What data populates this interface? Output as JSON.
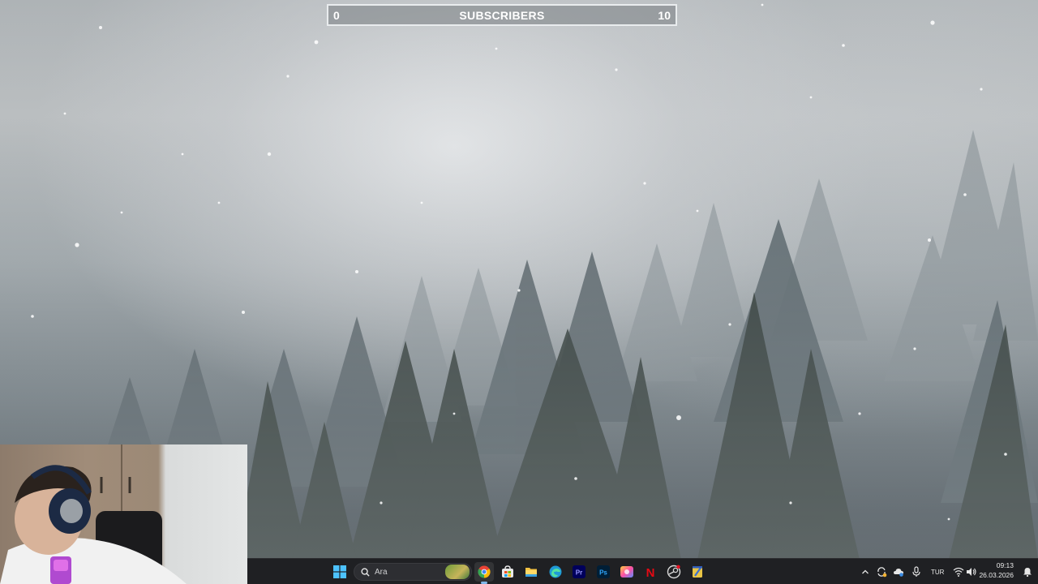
{
  "subscribers": {
    "current": "0",
    "title": "SUBSCRIBERS",
    "goal": "10",
    "progress": 0
  },
  "taskbar": {
    "search_label": "Ara",
    "apps": [
      {
        "name": "chrome-icon",
        "active": true
      },
      {
        "name": "store-icon",
        "active": false
      },
      {
        "name": "file-explorer-icon",
        "active": false
      },
      {
        "name": "edge-icon",
        "active": false
      },
      {
        "name": "premiere-pro-icon",
        "active": false
      },
      {
        "name": "photoshop-icon",
        "active": false
      },
      {
        "name": "color-app-icon",
        "active": false
      },
      {
        "name": "netflix-icon",
        "active": false
      },
      {
        "name": "steam-icon",
        "active": false
      },
      {
        "name": "notepad-icon",
        "active": false
      }
    ],
    "premiere_label": "Pr",
    "photoshop_label": "Ps",
    "netflix_label": "N",
    "language": "TUR",
    "time": "09:13",
    "date": "26.03.2026"
  },
  "colors": {
    "taskbar_bg": "#1f2023",
    "accent": "#7fb6e8",
    "chrome_red": "#ea4335",
    "chrome_yellow": "#fbbc05",
    "chrome_green": "#34a853",
    "chrome_blue": "#4285f4",
    "premiere": "#9999ff",
    "photoshop": "#31a8ff",
    "netflix": "#e50914"
  }
}
